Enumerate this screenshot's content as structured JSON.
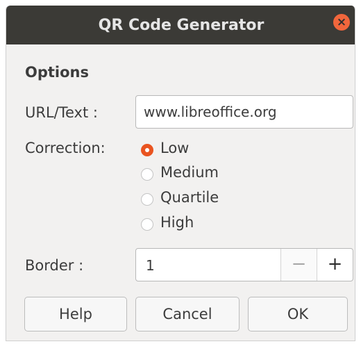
{
  "window": {
    "title": "QR Code Generator",
    "close_icon": "close-icon",
    "close_color": "#f1663c",
    "titlebar_color": "#3b3a36"
  },
  "options": {
    "heading": "Options",
    "url_label": "URL/Text :",
    "url_value": "www.libreoffice.org",
    "correction_label": "Correction:",
    "correction_options": [
      "Low",
      "Medium",
      "Quartile",
      "High"
    ],
    "correction_selected": "Low",
    "accent_color": "#e95420",
    "border_label": "Border :",
    "border_value": "1",
    "decrement": "−",
    "increment": "+"
  },
  "buttons": {
    "help": "Help",
    "cancel": "Cancel",
    "ok": "OK"
  }
}
